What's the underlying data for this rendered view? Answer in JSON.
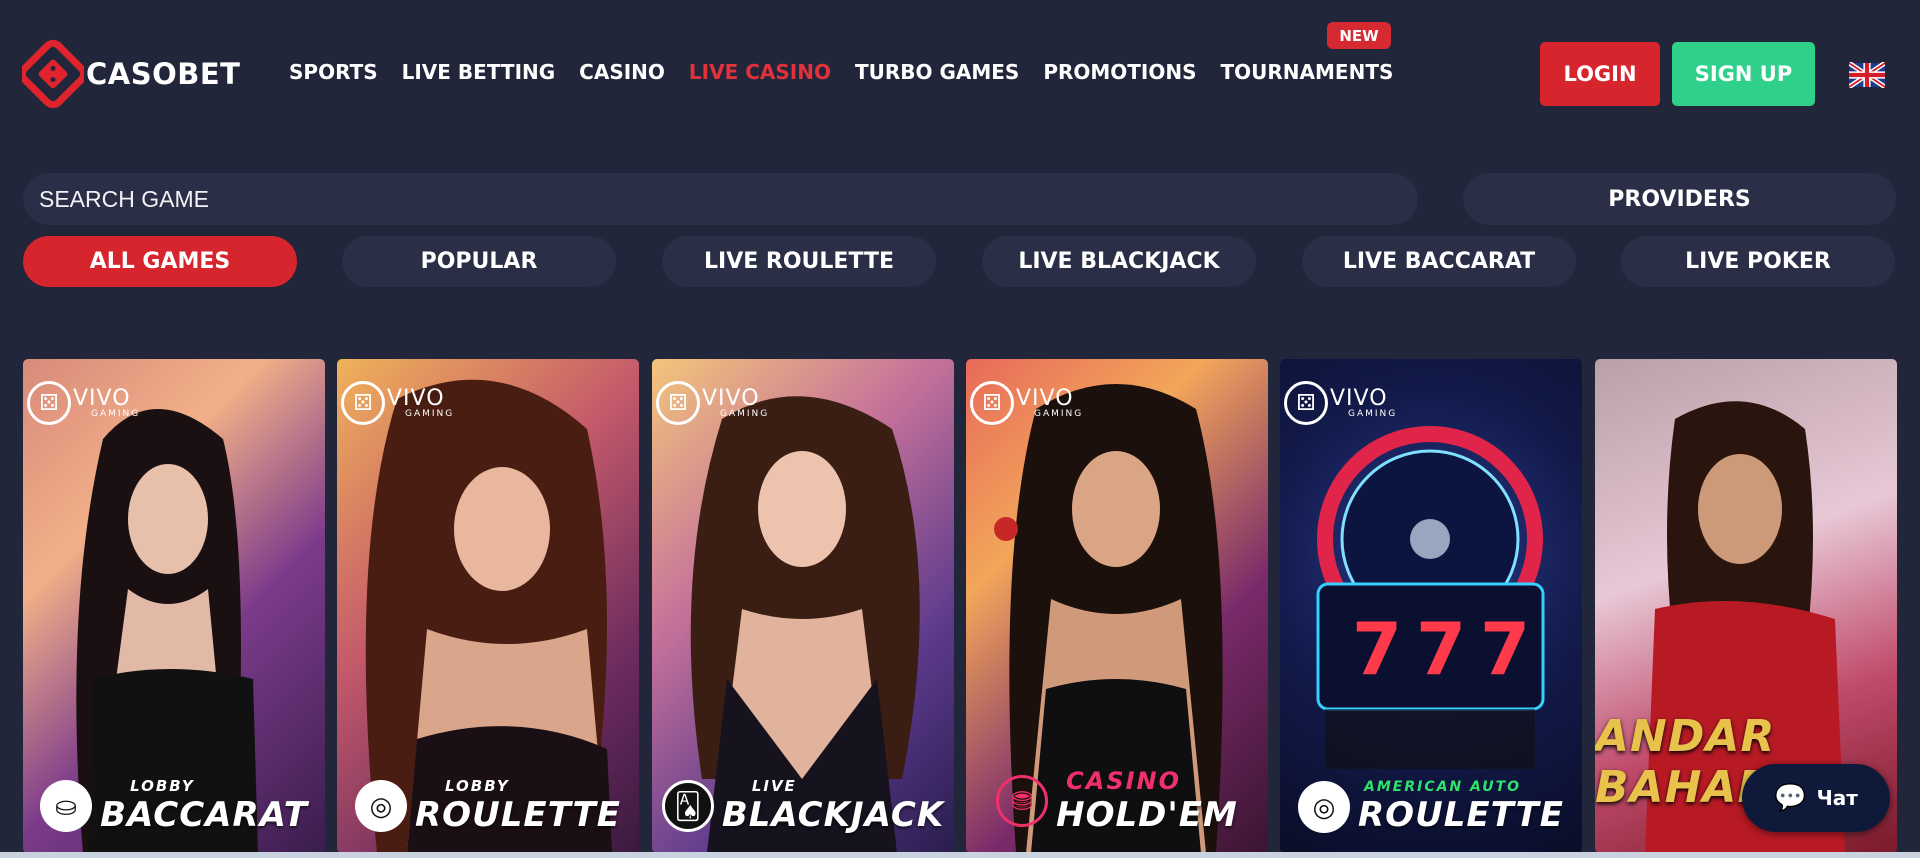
{
  "brand": {
    "name": "CASOBET",
    "accent": "#d7252e",
    "signup_color": "#2ed08a",
    "bg": "#22263b"
  },
  "nav": {
    "items": [
      {
        "label": "SPORTS",
        "active": false
      },
      {
        "label": "LIVE BETTING",
        "active": false
      },
      {
        "label": "CASINO",
        "active": false
      },
      {
        "label": "LIVE CASINO",
        "active": true
      },
      {
        "label": "TURBO GAMES",
        "active": false
      },
      {
        "label": "PROMOTIONS",
        "active": false
      },
      {
        "label": "TOURNAMENTS",
        "active": false
      }
    ],
    "new_badge": "NEW"
  },
  "auth": {
    "login": "LOGIN",
    "signup": "SIGN UP"
  },
  "language": {
    "icon": "uk-flag-icon"
  },
  "search": {
    "placeholder": "SEARCH GAME",
    "providers": "PROVIDERS"
  },
  "filters": [
    {
      "label": "ALL GAMES",
      "active": true
    },
    {
      "label": "POPULAR",
      "active": false
    },
    {
      "label": "LIVE ROULETTE",
      "active": false
    },
    {
      "label": "LIVE BLACKJACK",
      "active": false
    },
    {
      "label": "LIVE BACCARAT",
      "active": false
    },
    {
      "label": "LIVE POKER",
      "active": false
    }
  ],
  "games": [
    {
      "provider": "VIVO",
      "provider_sub": "GAMING",
      "sub": "LOBBY",
      "title": "BACCARAT",
      "icon": "chip-icon"
    },
    {
      "provider": "VIVO",
      "provider_sub": "GAMING",
      "sub": "LOBBY",
      "title": "ROULETTE",
      "icon": "roulette-icon"
    },
    {
      "provider": "VIVO",
      "provider_sub": "GAMING",
      "sub": "LIVE",
      "title": "BLACKJACK",
      "icon": "cards-icon"
    },
    {
      "provider": "VIVO",
      "provider_sub": "GAMING",
      "sub": "CASINO",
      "title": "HOLD'EM",
      "icon": "chips-icon"
    },
    {
      "provider": "VIVO",
      "provider_sub": "GAMING",
      "sub": "AMERICAN AUTO",
      "title": "ROULETTE",
      "icon": "roulette-icon"
    },
    {
      "provider": "",
      "provider_sub": "",
      "sub": "",
      "title": "ANDAR BAHAR",
      "icon": ""
    }
  ],
  "chat": {
    "label": "Чат",
    "icon": "chat-bubble-icon"
  }
}
